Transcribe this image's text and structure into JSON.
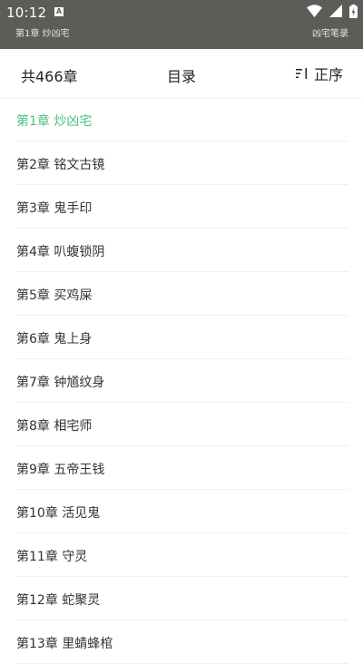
{
  "status_bar": {
    "time": "10:12",
    "notification_icon": "A"
  },
  "reader_header": {
    "chapter": "第1章 炒凶宅",
    "book": "凶宅笔录"
  },
  "toc_header": {
    "count": "共466章",
    "title": "目录",
    "sort_label": "正序"
  },
  "colors": {
    "active": "#4cc27f",
    "status_bg": "#5e5c58"
  },
  "chapters": [
    {
      "label": "第1章 炒凶宅",
      "active": true
    },
    {
      "label": "第2章 铭文古镜"
    },
    {
      "label": "第3章 鬼手印"
    },
    {
      "label": "第4章 叭蝮锁阴"
    },
    {
      "label": "第5章 买鸡屎"
    },
    {
      "label": "第6章 鬼上身"
    },
    {
      "label": "第7章 钟馗纹身"
    },
    {
      "label": "第8章 相宅师"
    },
    {
      "label": "第9章 五帝王钱"
    },
    {
      "label": "第10章 活见鬼"
    },
    {
      "label": "第11章 守灵"
    },
    {
      "label": "第12章 蛇聚灵"
    },
    {
      "label": "第13章 里蜻蜂棺"
    }
  ]
}
